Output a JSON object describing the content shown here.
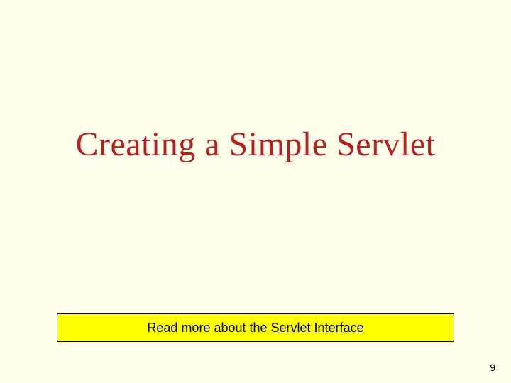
{
  "title": "Creating a Simple Servlet",
  "callout": {
    "prefix": "Read more about the ",
    "link_text": "Servlet Interface"
  },
  "page_number": "9"
}
